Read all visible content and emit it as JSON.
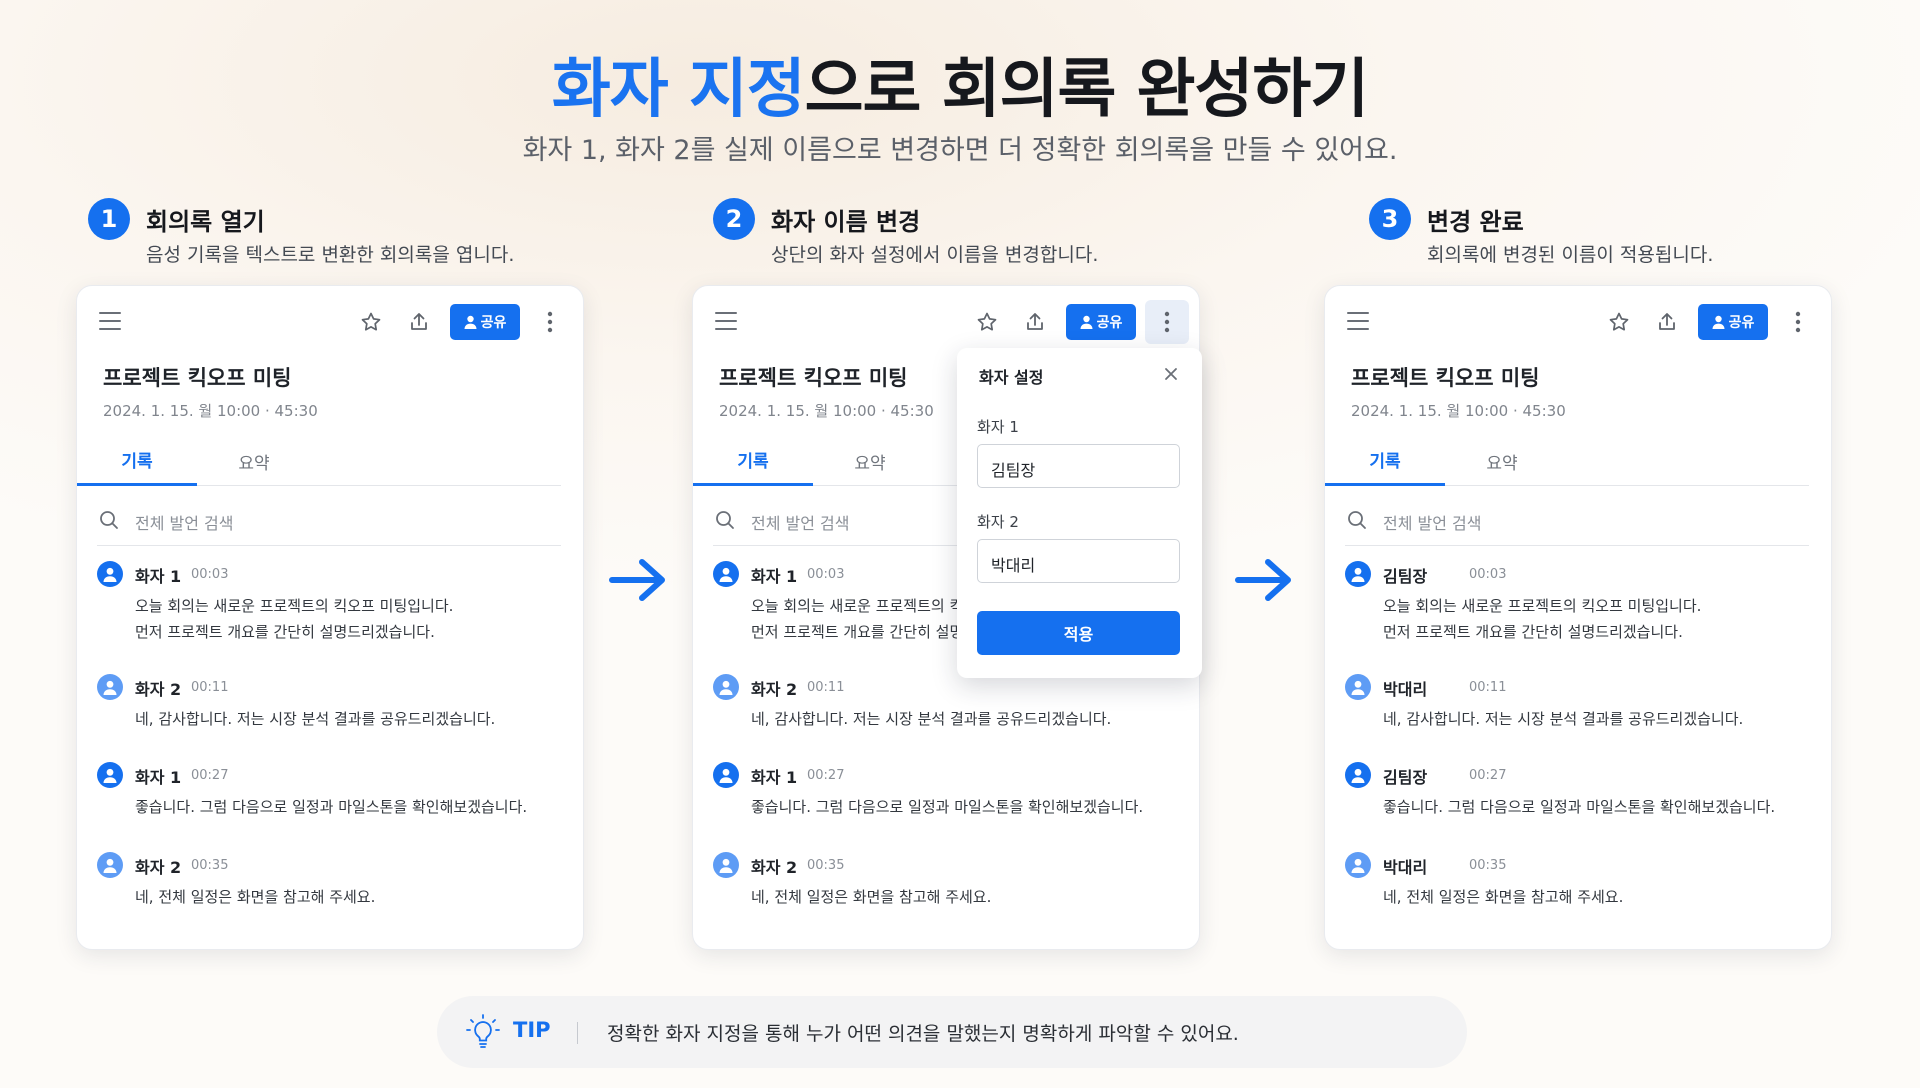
{
  "hero": {
    "title_accent": "화자 지정",
    "title_rest": "으로 회의록 완성하기",
    "subtitle": "화자 1, 화자 2를 실제 이름으로 변경하면 더 정확한 회의록을 만들 수 있어요."
  },
  "steps": [
    {
      "num": "1",
      "title": "회의록 열기",
      "desc": "음성 기록을 텍스트로 변환한 회의록을 엽니다."
    },
    {
      "num": "2",
      "title": "화자 이름 변경",
      "desc": "상단의 화자 설정에서 이름을 변경합니다."
    },
    {
      "num": "3",
      "title": "변경 완료",
      "desc": "회의록에 변경된 이름이 적용됩니다."
    }
  ],
  "card": {
    "title": "프로젝트 킥오프 미팅",
    "meta": "2024. 1. 15. 월 10:00 · 45:30",
    "tabs": [
      "기록",
      "요약"
    ],
    "search_placeholder": "전체 발언 검색",
    "share_label": "공유"
  },
  "transcript": [
    {
      "time": "00:03",
      "lines": [
        "오늘 회의는 새로운 프로젝트의 킥오프 미팅입니다.",
        "먼저 프로젝트 개요를 간단히 설명드리겠습니다."
      ]
    },
    {
      "time": "00:11",
      "lines": [
        "네, 감사합니다. 저는 시장 분석 결과를 공유드리겠습니다."
      ]
    },
    {
      "time": "00:27",
      "lines": [
        "좋습니다. 그럼 다음으로 일정과 마일스톤을 확인해보겠습니다."
      ]
    },
    {
      "time": "00:35",
      "lines": [
        "네, 전체 일정은 화면을 참고해 주세요."
      ]
    }
  ],
  "speakers_before": [
    "화자 1",
    "화자 2",
    "화자 1",
    "화자 2"
  ],
  "speakers_after": [
    "김팀장",
    "박대리",
    "김팀장",
    "박대리"
  ],
  "panel": {
    "title": "화자 설정",
    "label1": "화자 1",
    "value1": "김팀장",
    "label2": "화자 2",
    "value2": "박대리",
    "apply": "적용"
  },
  "tip": {
    "label": "TIP",
    "text": "정확한 화자 지정을 통해 누가 어떤 의견을 말했는지 명확하게 파악할 수 있어요."
  },
  "colors": {
    "accent": "#1570ef",
    "avatar_alt": "#5e9cf5"
  }
}
